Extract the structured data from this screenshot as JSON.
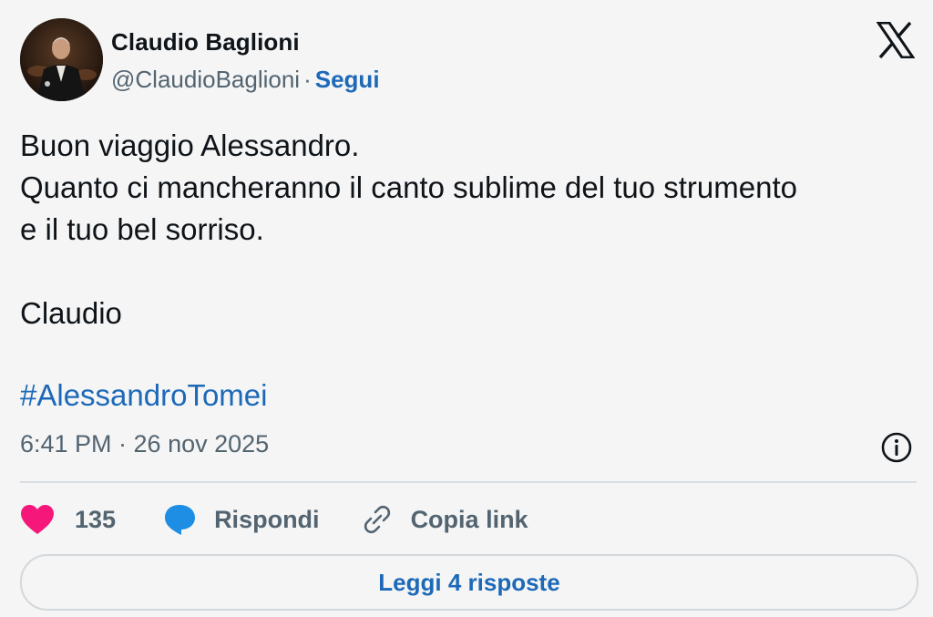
{
  "author": {
    "name": "Claudio Baglioni",
    "handle": "@ClaudioBaglioni",
    "separator": "·",
    "follow_label": "Segui",
    "avatar_icon": "profile-photo"
  },
  "platform_icon": "x-logo-icon",
  "tweet": {
    "lines": [
      "Buon viaggio Alessandro.",
      "Quanto ci mancheranno il canto sublime del tuo strumento",
      "e il tuo bel sorriso.",
      "",
      "Claudio"
    ],
    "hashtag": "#AlessandroTomei"
  },
  "meta": {
    "timestamp": "6:41 PM · 26 nov 2025",
    "info_icon": "info-icon"
  },
  "actions": {
    "like_count": "135",
    "reply_label": "Rispondi",
    "copy_link_label": "Copia link"
  },
  "read_replies_label": "Leggi 4 risposte",
  "colors": {
    "accent": "#1d69b8",
    "like": "#f6177a",
    "reply_bubble": "#1d8ee3",
    "secondary_text": "#536471",
    "divider": "#d8dde1"
  }
}
